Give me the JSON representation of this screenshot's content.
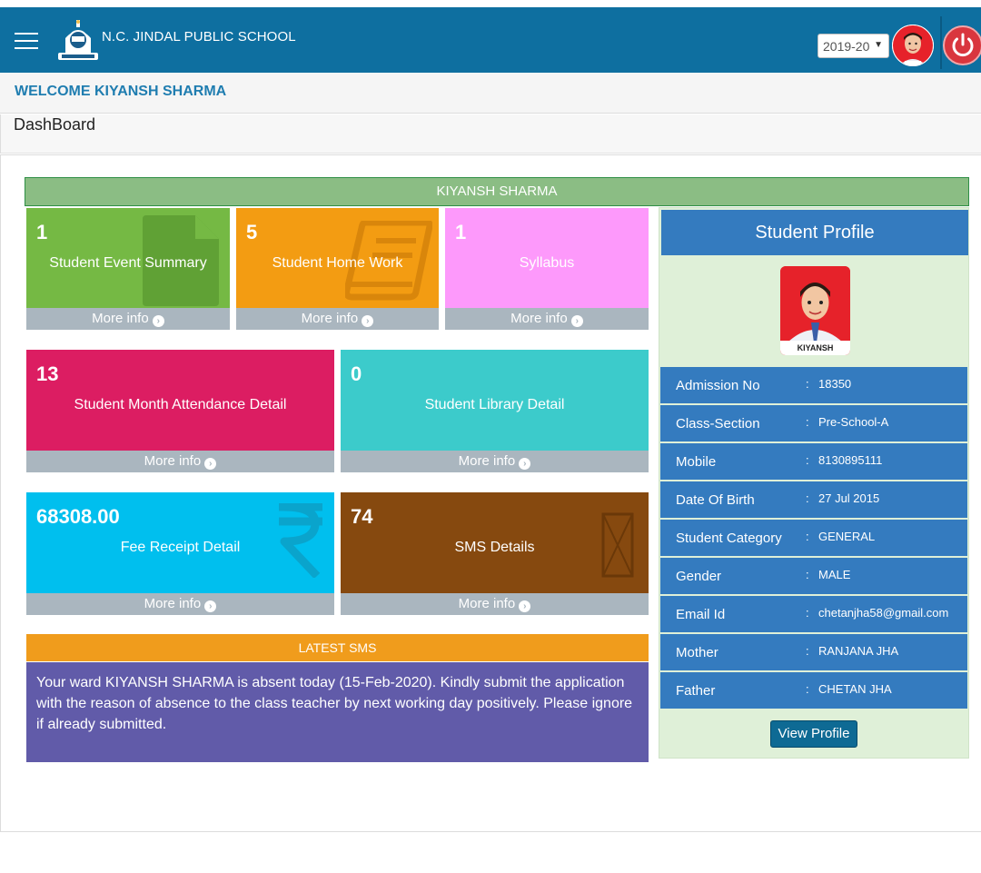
{
  "header": {
    "school_name": "N.C. JINDAL PUBLIC SCHOOL",
    "session": "2019-20",
    "colors": {
      "topbar": "#0e6fa0",
      "power": "#d9363e"
    },
    "icons": [
      "menu-icon",
      "school-logo",
      "user-avatar",
      "power-icon"
    ]
  },
  "welcome": {
    "text": "WELCOME KIYANSH SHARMA"
  },
  "page": {
    "title": "DashBoard"
  },
  "student_banner": "KIYANSH SHARMA",
  "tiles": [
    {
      "count": "1",
      "label": "Student Event Summary",
      "more": "More info",
      "color": "#75b944",
      "icon": "file-icon"
    },
    {
      "count": "5",
      "label": "Student Home Work",
      "more": "More info",
      "color": "#f39c12",
      "icon": "book-icon"
    },
    {
      "count": "1",
      "label": "Syllabus",
      "more": "More info",
      "color": "#fd99fb",
      "icon": ""
    },
    {
      "count": "13",
      "label": "Student Month Attendance Detail",
      "more": "More info",
      "color": "#dc1d62",
      "icon": ""
    },
    {
      "count": "0",
      "label": "Student Library Detail",
      "more": "More info",
      "color": "#3ccbcb",
      "icon": ""
    },
    {
      "count": "68308.00",
      "label": "Fee Receipt Detail",
      "more": "More info",
      "color": "#00bfee",
      "icon": "rupee-icon"
    },
    {
      "count": "74",
      "label": "SMS Details",
      "more": "More info",
      "color": "#86490f",
      "icon": "empty-box-icon"
    }
  ],
  "latest_sms": {
    "title": "LATEST SMS",
    "message": "Your ward KIYANSH SHARMA is absent today (15-Feb-2020). Kindly submit the application with the reason of absence to the class teacher by next working day positively. Please ignore if already submitted."
  },
  "profile": {
    "title": "Student Profile",
    "photo_caption": "KIYANSH SHARMA",
    "separator": ":",
    "rows": [
      {
        "label": "Admission No",
        "value": "18350"
      },
      {
        "label": "Class-Section",
        "value": "Pre-School-A"
      },
      {
        "label": "Mobile",
        "value": "8130895111"
      },
      {
        "label": "Date Of Birth",
        "value": "27 Jul 2015"
      },
      {
        "label": "Student Category",
        "value": "GENERAL"
      },
      {
        "label": "Gender",
        "value": "MALE"
      },
      {
        "label": "Email Id",
        "value": "chetanjha58@gmail.com"
      },
      {
        "label": "Mother",
        "value": "RANJANA JHA"
      },
      {
        "label": "Father",
        "value": "CHETAN JHA"
      }
    ],
    "view_button": "View Profile"
  }
}
